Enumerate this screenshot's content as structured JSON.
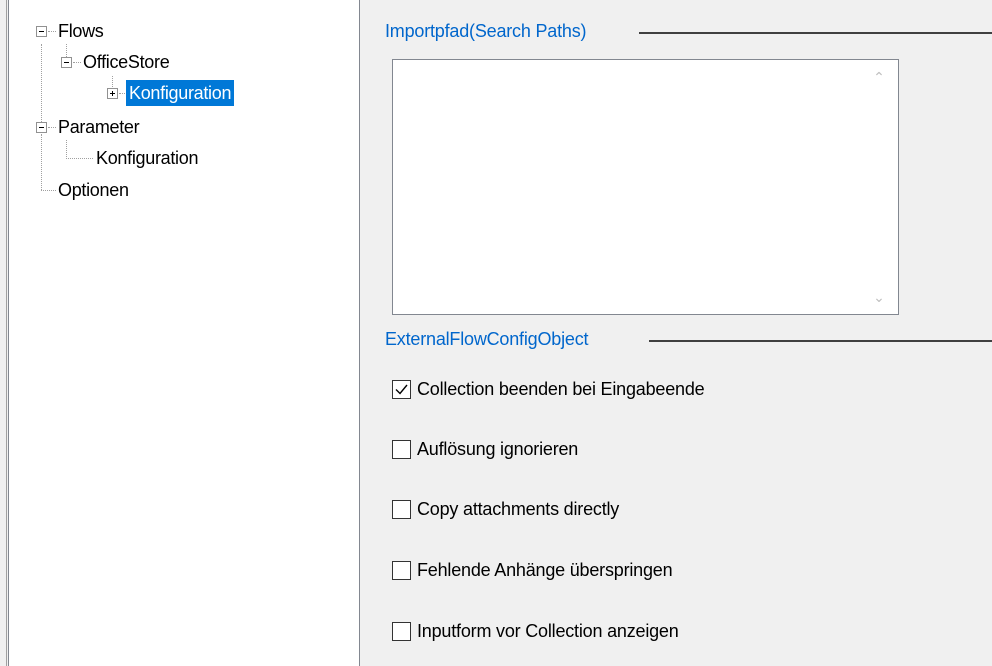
{
  "tree": {
    "flows": "Flows",
    "office_store": "OfficeStore",
    "konfiguration_flow": "Konfiguration",
    "parameter": "Parameter",
    "konfiguration_param": "Konfiguration",
    "optionen": "Optionen"
  },
  "search_paths": {
    "title": "Importpfad(Search Paths)",
    "items": []
  },
  "external_config": {
    "title": "ExternalFlowConfigObject",
    "options": [
      {
        "label": "Collection beenden bei Eingabeende",
        "checked": true
      },
      {
        "label": "Auflösung ignorieren",
        "checked": false
      },
      {
        "label": "Copy attachments directly",
        "checked": false
      },
      {
        "label": "Fehlende Anhänge überspringen",
        "checked": false
      },
      {
        "label": "Inputform vor Collection anzeigen",
        "checked": false
      }
    ]
  },
  "colors": {
    "selection": "#0078d7",
    "group_title": "#0066cc"
  }
}
